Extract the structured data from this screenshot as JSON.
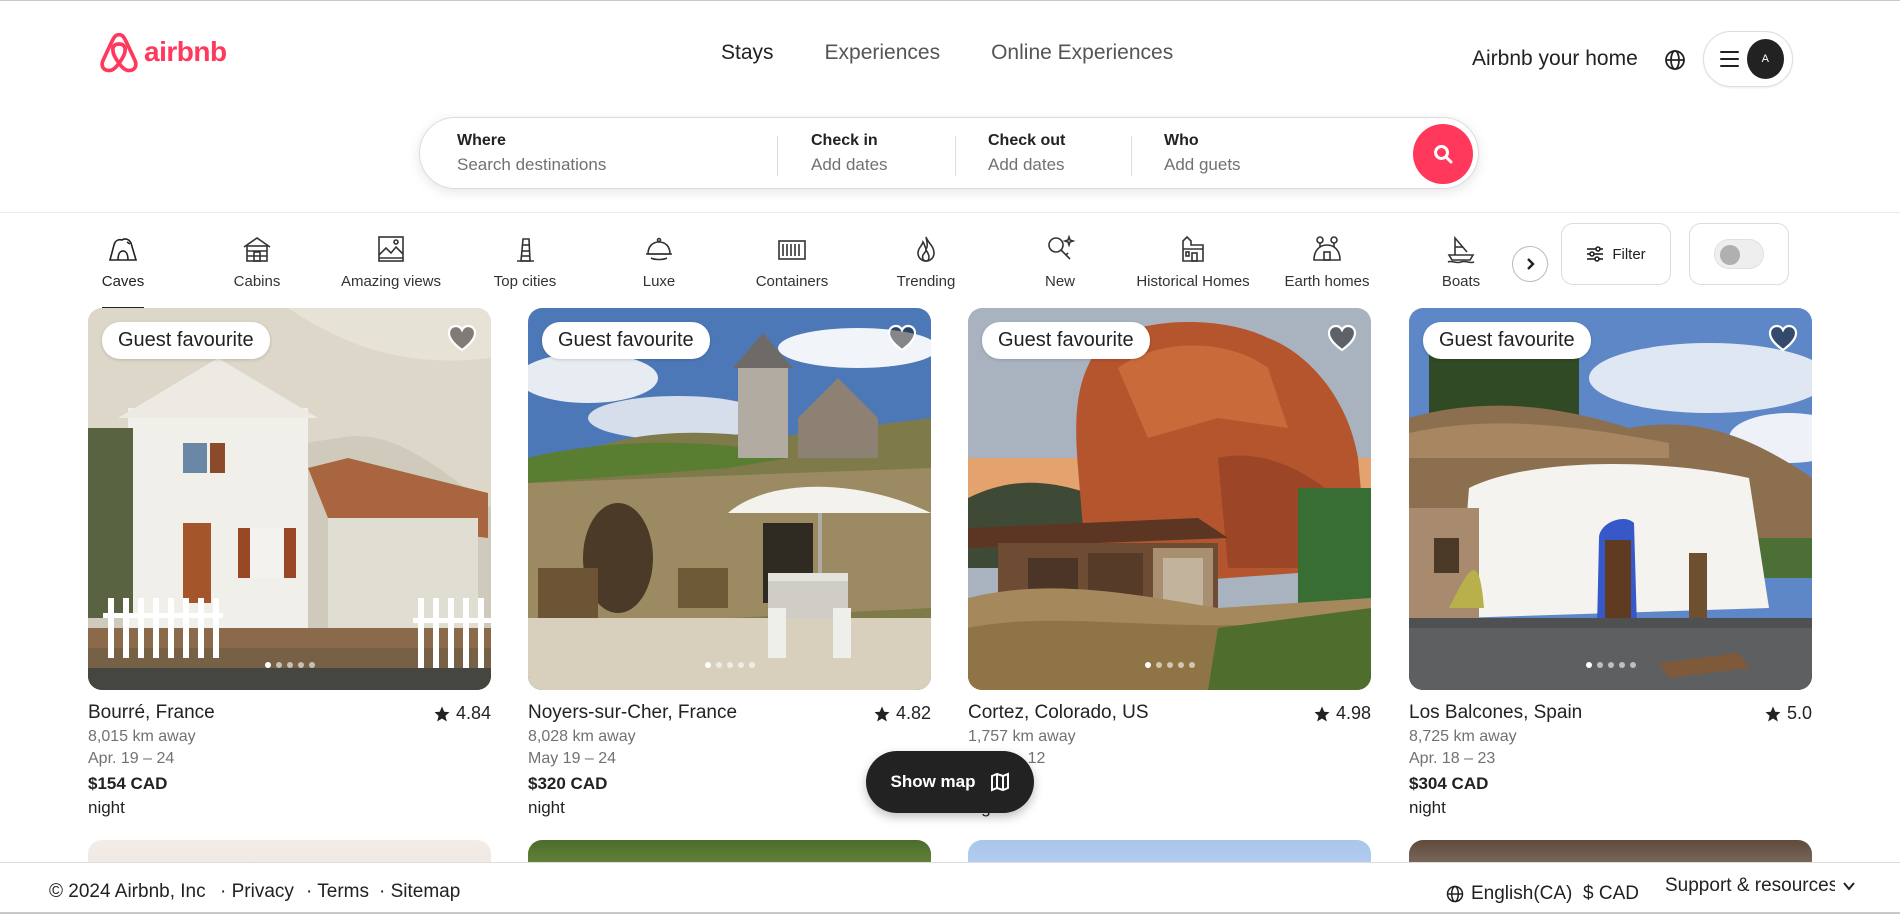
{
  "brand": {
    "name": "airbnb",
    "color": "#ff385c"
  },
  "nav": {
    "tabs": [
      "Stays",
      "Experiences",
      "Online Experiences"
    ],
    "active": "Stays"
  },
  "header": {
    "host_link": "Airbnb your home",
    "avatar_initial": "A"
  },
  "search": {
    "where": {
      "label": "Where",
      "placeholder": "Search destinations"
    },
    "check_in": {
      "label": "Check in",
      "value": "Add dates"
    },
    "check_out": {
      "label": "Check out",
      "value": "Add dates"
    },
    "who": {
      "label": "Who",
      "value": "Add guets"
    }
  },
  "categories": [
    {
      "label": "Caves",
      "icon": "cave-icon",
      "active": true
    },
    {
      "label": "Cabins",
      "icon": "cabin-icon"
    },
    {
      "label": "Amazing views",
      "icon": "views-icon"
    },
    {
      "label": "Top cities",
      "icon": "tower-icon"
    },
    {
      "label": "Luxe",
      "icon": "bell-icon"
    },
    {
      "label": "Containers",
      "icon": "container-icon"
    },
    {
      "label": "Trending",
      "icon": "flame-icon"
    },
    {
      "label": "New",
      "icon": "sparkle-key-icon"
    },
    {
      "label": "Historical Homes",
      "icon": "historic-home-icon"
    },
    {
      "label": "Earth homes",
      "icon": "earth-home-icon"
    },
    {
      "label": "Boats",
      "icon": "boat-icon"
    }
  ],
  "filter": {
    "label": "Filter"
  },
  "listings": [
    {
      "badge": "Guest favourite",
      "title": "Bourré, France",
      "rating": "4.84",
      "distance": "8,015 km away",
      "dates": "Apr. 19 – 24",
      "price": "$154 CAD",
      "per": "night"
    },
    {
      "badge": "Guest favourite",
      "title": "Noyers-sur-Cher, France",
      "rating": "4.82",
      "distance": "8,028 km away",
      "dates": "May 19 – 24",
      "price": "$320 CAD",
      "per": "night"
    },
    {
      "badge": "Guest favourite",
      "title": "Cortez, Colorado, US",
      "rating": "4.98",
      "distance": "1,757 km away",
      "dates": "Apr. 7 – 12",
      "price": "$ CAD",
      "per": "night"
    },
    {
      "badge": "Guest favourite",
      "title": "Los Balcones, Spain",
      "rating": "5.0",
      "distance": "8,725 km away",
      "dates": "Apr. 18 – 23",
      "price": "$304 CAD",
      "per": "night"
    }
  ],
  "show_map": {
    "label": "Show map"
  },
  "footer": {
    "copyright": "© 2024 Airbnb, Inc",
    "links": [
      "· Privacy",
      "· Terms",
      "· Sitemap"
    ],
    "language": "English(CA)",
    "currency": "$ CAD",
    "support": "Support & resources"
  }
}
